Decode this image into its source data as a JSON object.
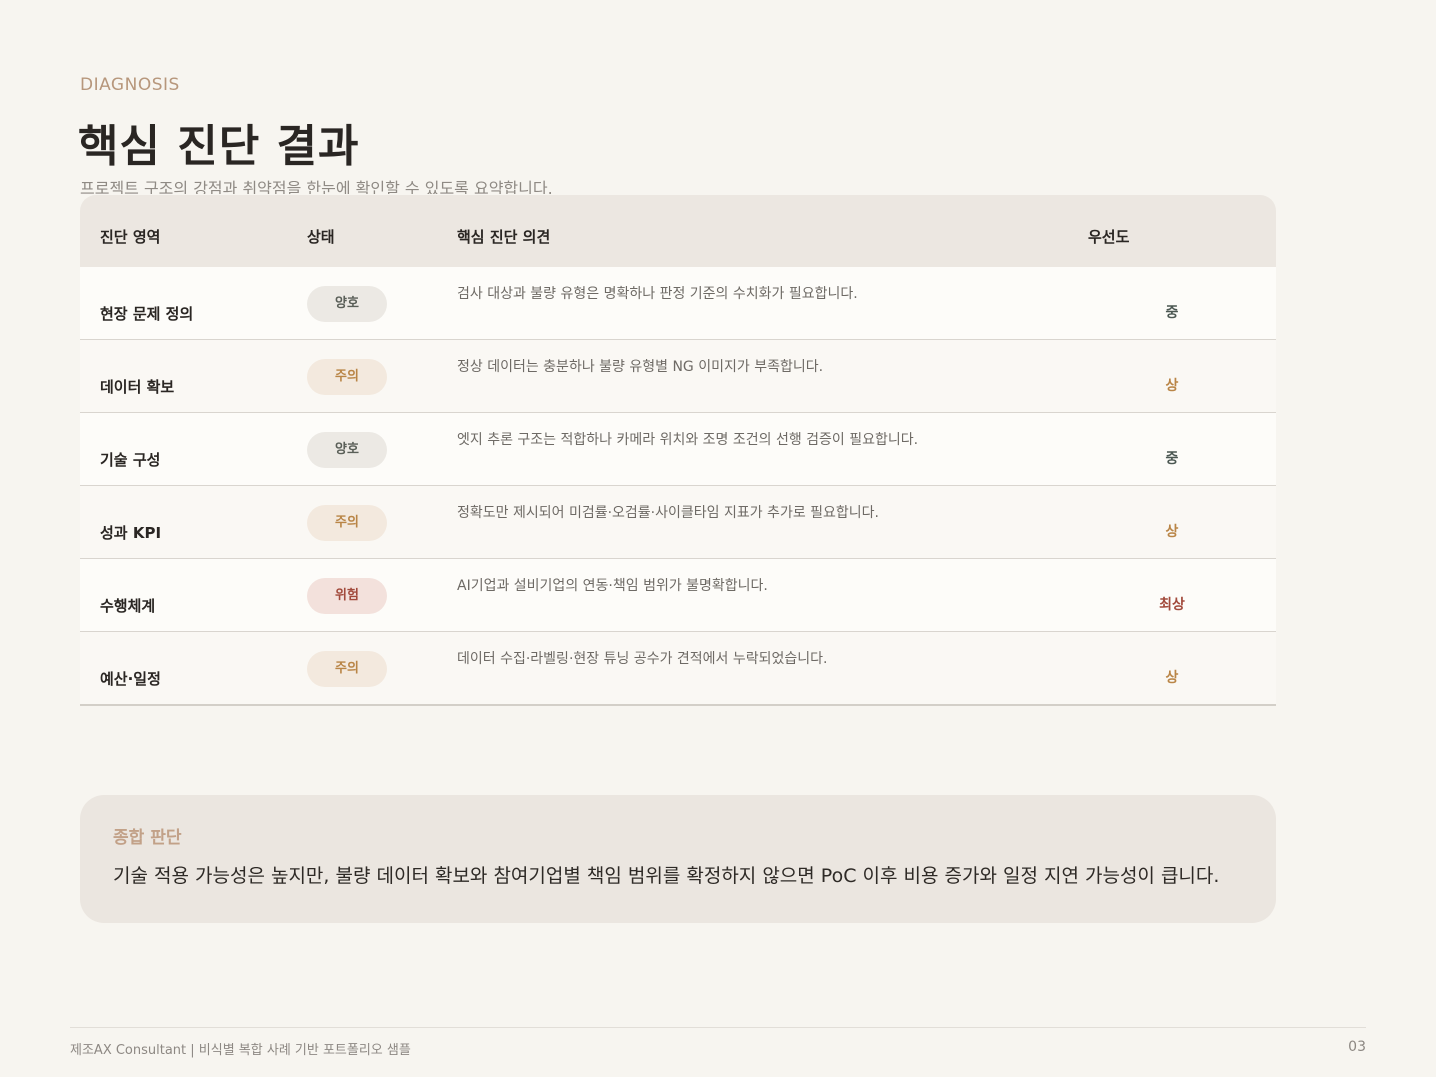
{
  "header": {
    "eyebrow": "DIAGNOSIS",
    "title": "핵심 진단 결과",
    "subtitle": "프로젝트 구조의 강점과 취약점을 한눈에 확인할 수 있도록 요약합니다."
  },
  "table": {
    "columns": [
      "진단 영역",
      "상태",
      "핵심 진단 의견",
      "우선도"
    ],
    "rows": [
      {
        "area": "현장 문제 정의",
        "status": "양호",
        "status_kind": "good",
        "opinion": "검사 대상과 불량 유형은 명확하나 판정 기준의 수치화가 필요합니다.",
        "priority": "중",
        "priority_kind": "mid"
      },
      {
        "area": "데이터 확보",
        "status": "주의",
        "status_kind": "caution",
        "opinion": "정상 데이터는 충분하나 불량 유형별 NG 이미지가 부족합니다.",
        "priority": "상",
        "priority_kind": "high"
      },
      {
        "area": "기술 구성",
        "status": "양호",
        "status_kind": "good",
        "opinion": "엣지 추론 구조는 적합하나 카메라 위치와 조명 조건의 선행 검증이 필요합니다.",
        "priority": "중",
        "priority_kind": "mid"
      },
      {
        "area": "성과 KPI",
        "status": "주의",
        "status_kind": "caution",
        "opinion": "정확도만 제시되어 미검률·오검률·사이클타임 지표가 추가로 필요합니다.",
        "priority": "상",
        "priority_kind": "high"
      },
      {
        "area": "수행체계",
        "status": "위험",
        "status_kind": "risk",
        "opinion": "AI기업과 설비기업의 연동·책임 범위가 불명확합니다.",
        "priority": "최상",
        "priority_kind": "top"
      },
      {
        "area": "예산·일정",
        "status": "주의",
        "status_kind": "caution",
        "opinion": "데이터 수집·라벨링·현장 튜닝 공수가 견적에서 누락되었습니다.",
        "priority": "상",
        "priority_kind": "high"
      }
    ]
  },
  "summary": {
    "label": "종합 판단",
    "text": "기술 적용 가능성은 높지만, 불량 데이터 확보와 참여기업별 책임 범위를 확정하지 않으면 PoC 이후 비용 증가와 일정 지연 가능성이 큽니다."
  },
  "footer": {
    "left": "제조AX Consultant | 비식별 복합 사례 기반 포트폴리오 샘플",
    "page": "03"
  },
  "colors": {
    "background": "#f7f5f0",
    "accent": "#b7977c",
    "status_good": "#5a5f58",
    "status_caution": "#b98546",
    "status_risk": "#a24a3c"
  }
}
